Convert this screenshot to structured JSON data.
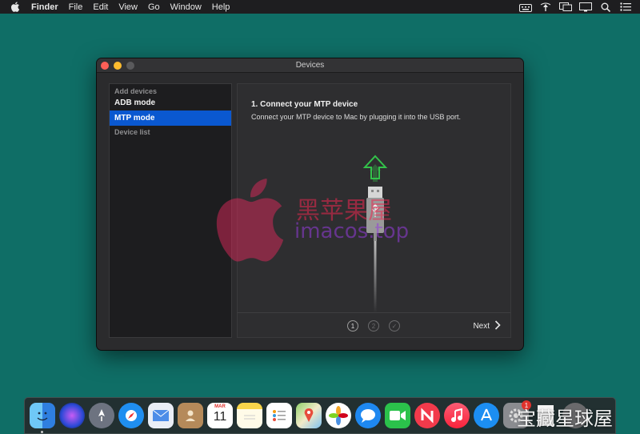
{
  "menubar": {
    "app_name": "Finder",
    "items": [
      "File",
      "Edit",
      "View",
      "Go",
      "Window",
      "Help"
    ],
    "right_icons": [
      "keyboard-icon",
      "airplay-icon",
      "display-icon",
      "screen-mirror-icon",
      "spotlight-icon",
      "notification-center-icon"
    ]
  },
  "window": {
    "title": "Devices",
    "sidebar": {
      "section_add": "Add devices",
      "adb_mode": "ADB mode",
      "mtp_mode": "MTP mode",
      "section_list": "Device list",
      "selected": "MTP mode"
    },
    "content": {
      "step_title": "1. Connect your MTP device",
      "step_description": "Connect your MTP device to Mac by plugging it into the USB port.",
      "steps": [
        "1",
        "2",
        "✓"
      ],
      "current_step": 1,
      "next_label": "Next"
    }
  },
  "watermark": {
    "line1": "黑苹果屋",
    "line2": "imacos.top",
    "corner": "宝藏星球屋"
  },
  "dock": {
    "calendar_month": "MAR",
    "calendar_day": "11",
    "badge_count": "1"
  },
  "colors": {
    "desktop": "#0f6e66",
    "selection": "#0a58d0",
    "arrow": "#33c24a"
  }
}
